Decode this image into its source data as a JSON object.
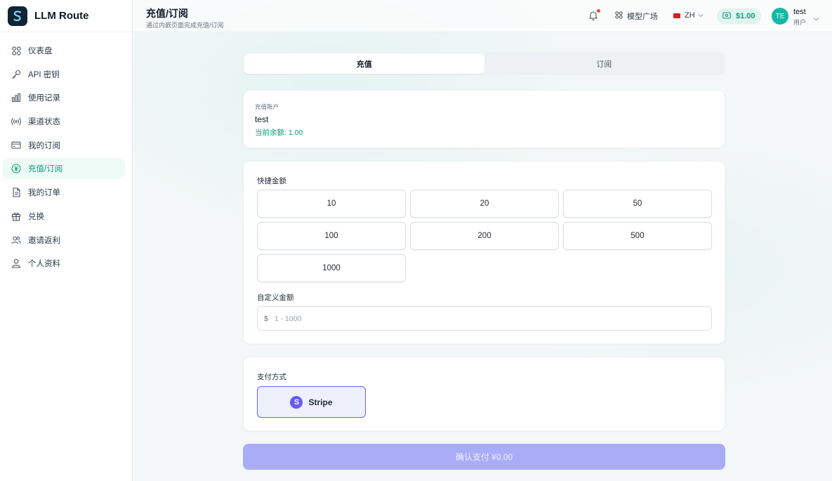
{
  "brand": {
    "name": "LLM Route"
  },
  "sidebar": {
    "items": [
      {
        "label": "仪表盘",
        "icon": "grid-icon"
      },
      {
        "label": "API 密钥",
        "icon": "key-icon"
      },
      {
        "label": "使用记录",
        "icon": "bar-chart-icon"
      },
      {
        "label": "渠道状态",
        "icon": "signal-icon"
      },
      {
        "label": "我的订阅",
        "icon": "card-icon"
      },
      {
        "label": "充值/订阅",
        "icon": "yen-icon",
        "active": true
      },
      {
        "label": "我的订单",
        "icon": "document-icon"
      },
      {
        "label": "兑换",
        "icon": "gift-icon"
      },
      {
        "label": "邀请返利",
        "icon": "users-icon"
      },
      {
        "label": "个人资料",
        "icon": "user-icon"
      }
    ]
  },
  "header": {
    "title": "充值/订阅",
    "subtitle": "通过内嵌页面完成充值/订阅",
    "market_label": "模型广场",
    "lang": "ZH",
    "balance": "$1.00",
    "avatar_initials": "TE",
    "user_name": "test",
    "user_role": "用户"
  },
  "tabs": [
    {
      "label": "充值",
      "active": true
    },
    {
      "label": "订阅",
      "active": false
    }
  ],
  "account": {
    "caption": "充值账户",
    "username": "test",
    "balance_text": "当前余额: 1.00"
  },
  "amounts": {
    "label": "快捷金额",
    "options": [
      "10",
      "20",
      "50",
      "100",
      "200",
      "500",
      "1000"
    ],
    "custom_label": "自定义金额",
    "currency_symbol": "$",
    "custom_placeholder": "1 - 1000"
  },
  "payment": {
    "label": "支付方式",
    "method": "Stripe",
    "method_glyph": "S"
  },
  "confirm": {
    "label": "确认支付 ¥0.00"
  },
  "colors": {
    "accent": "#0f9d77",
    "stripe": "#635bff",
    "confirm_bg": "#a9adf8"
  }
}
